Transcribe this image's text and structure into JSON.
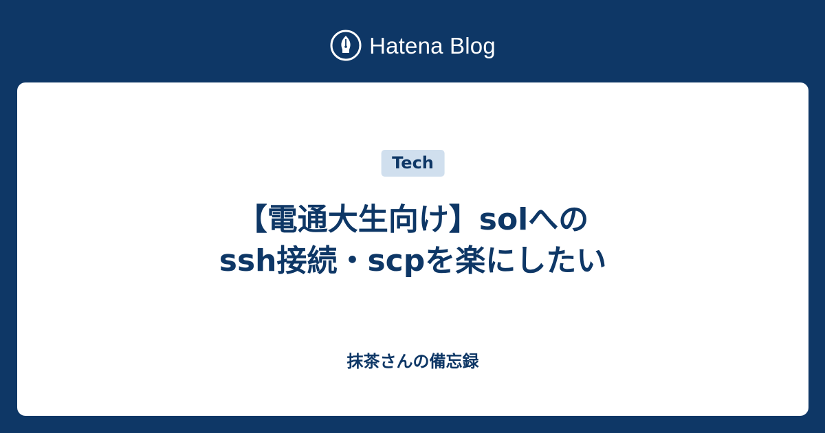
{
  "header": {
    "brand": "Hatena Blog",
    "logo_icon": "fountain-pen-nib-icon"
  },
  "card": {
    "tag": "Tech",
    "title_lines": [
      "【電通大生向け】solへの",
      "ssh接続・scpを楽にしたい"
    ],
    "blog_name": "抹茶さんの備忘録"
  },
  "colors": {
    "background": "#0e3766",
    "card": "#ffffff",
    "tag_background": "#d0dfee",
    "text": "#0e3766"
  }
}
